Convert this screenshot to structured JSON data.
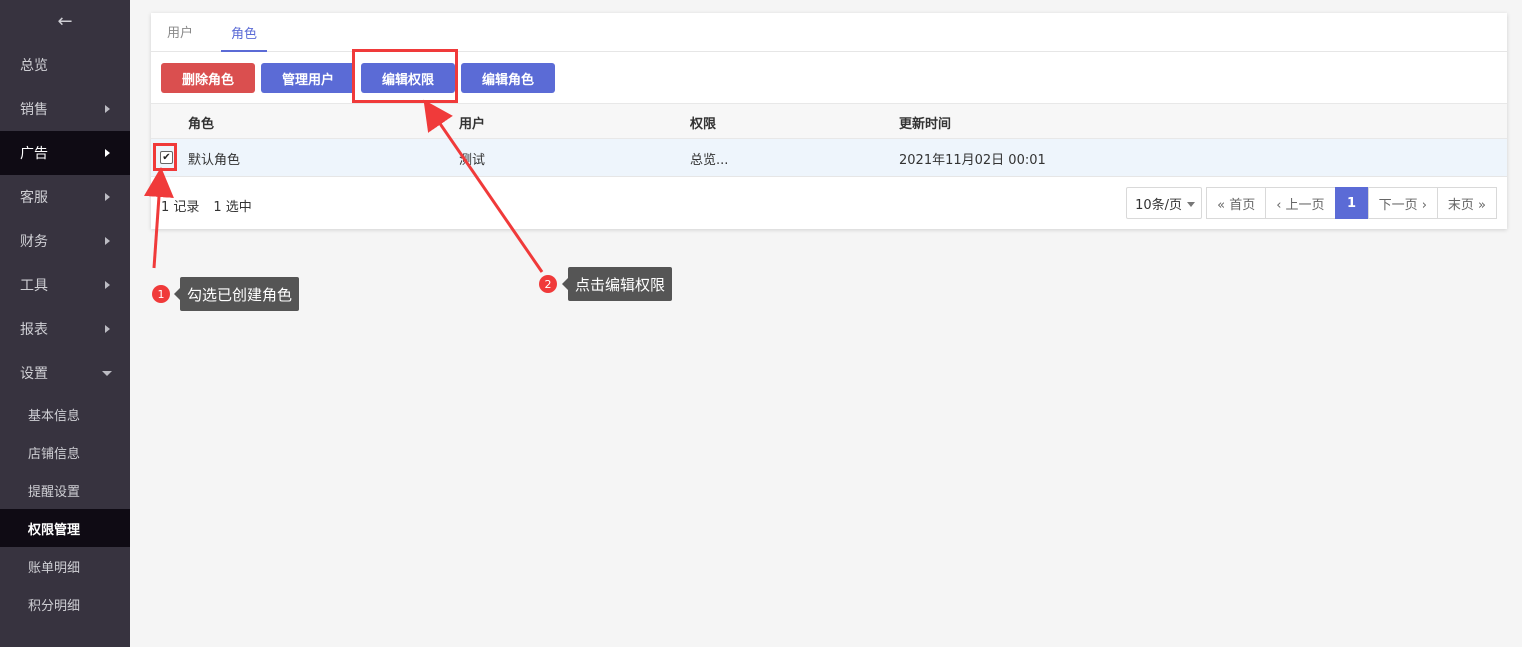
{
  "sidebar": {
    "back_icon": "arrow-left-icon",
    "items": [
      {
        "label": "总览"
      },
      {
        "label": "销售"
      },
      {
        "label": "广告"
      },
      {
        "label": "客服"
      },
      {
        "label": "财务"
      },
      {
        "label": "工具"
      },
      {
        "label": "报表"
      },
      {
        "label": "设置"
      }
    ],
    "sub_items": [
      {
        "label": "基本信息"
      },
      {
        "label": "店铺信息"
      },
      {
        "label": "提醒设置"
      },
      {
        "label": "权限管理"
      },
      {
        "label": "账单明细"
      },
      {
        "label": "积分明细"
      }
    ]
  },
  "tabs": [
    {
      "label": "用户"
    },
    {
      "label": "角色"
    }
  ],
  "toolbar": {
    "delete_role": "删除角色",
    "manage_users": "管理用户",
    "edit_permissions": "编辑权限",
    "edit_role": "编辑角色"
  },
  "table": {
    "headers": [
      "角色",
      "用户",
      "权限",
      "更新时间"
    ],
    "rows": [
      {
        "role": "默认角色",
        "user": "测试",
        "permission": "总览...",
        "updated": "2021年11月02日 00:01",
        "checked": true
      }
    ]
  },
  "footer": {
    "records": "1 记录",
    "selected": "1 选中"
  },
  "pager": {
    "page_size": "10条/页",
    "first": "« 首页",
    "prev": "‹ 上一页",
    "current": "1",
    "next": "下一页 ›",
    "last": "末页 »"
  },
  "annotations": {
    "step1_number": "1",
    "step1_text": "勾选已创建角色",
    "step2_number": "2",
    "step2_text": "点击编辑权限",
    "color": "#f03a3a"
  },
  "colors": {
    "sidebar_bg": "#37333f",
    "sidebar_active": "#0f0b14",
    "primary": "#5b6bd6",
    "danger": "#da4f4f"
  }
}
